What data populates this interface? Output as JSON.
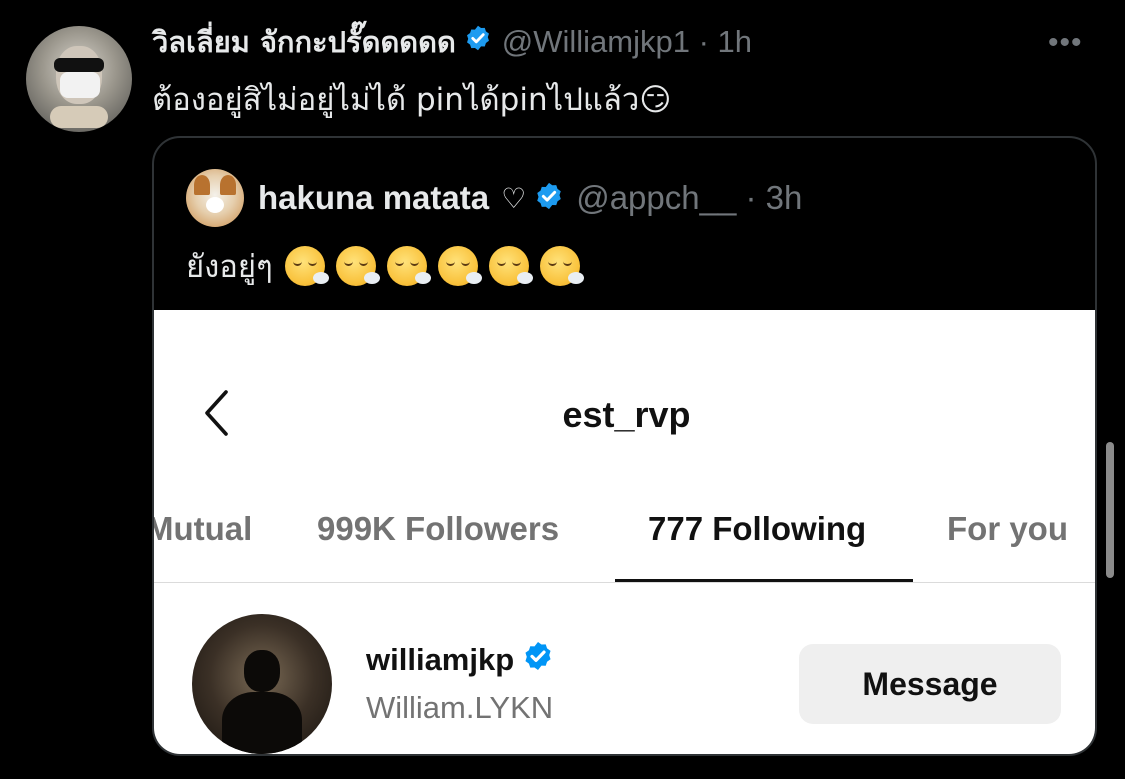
{
  "tweet": {
    "author_name": "วิลเลี่ยม จักกะปรั๊ดดดดด",
    "handle_time": "@Williamjkp1 · 1h",
    "text": "ต้องอยู่สิไม่อยู่ไม่ได้ pinได้pinไปแล้ว😏",
    "more_label": "•••"
  },
  "quote": {
    "author_name": "hakuna matata",
    "heart": "♡",
    "handle_time": "@appch__ · 3h",
    "text": "ยังอยู่ๆ",
    "emoji_count": 6,
    "emoji_icon": "face-exhaling-emoji"
  },
  "instagram": {
    "title": "est_rvp",
    "tabs": [
      {
        "label": "Mutual"
      },
      {
        "label": "999K Followers"
      },
      {
        "label": "777 Following"
      },
      {
        "label": "For you"
      }
    ],
    "active_tab": "777 Following",
    "user": {
      "username": "williamjkp",
      "full_name": "William.LYKN"
    },
    "message_button": "Message"
  },
  "colors": {
    "background": "#000000",
    "verified": "#1d9bf0",
    "muted": "#71767b",
    "ig_panel": "#ffffff",
    "ig_button": "#efefef"
  }
}
